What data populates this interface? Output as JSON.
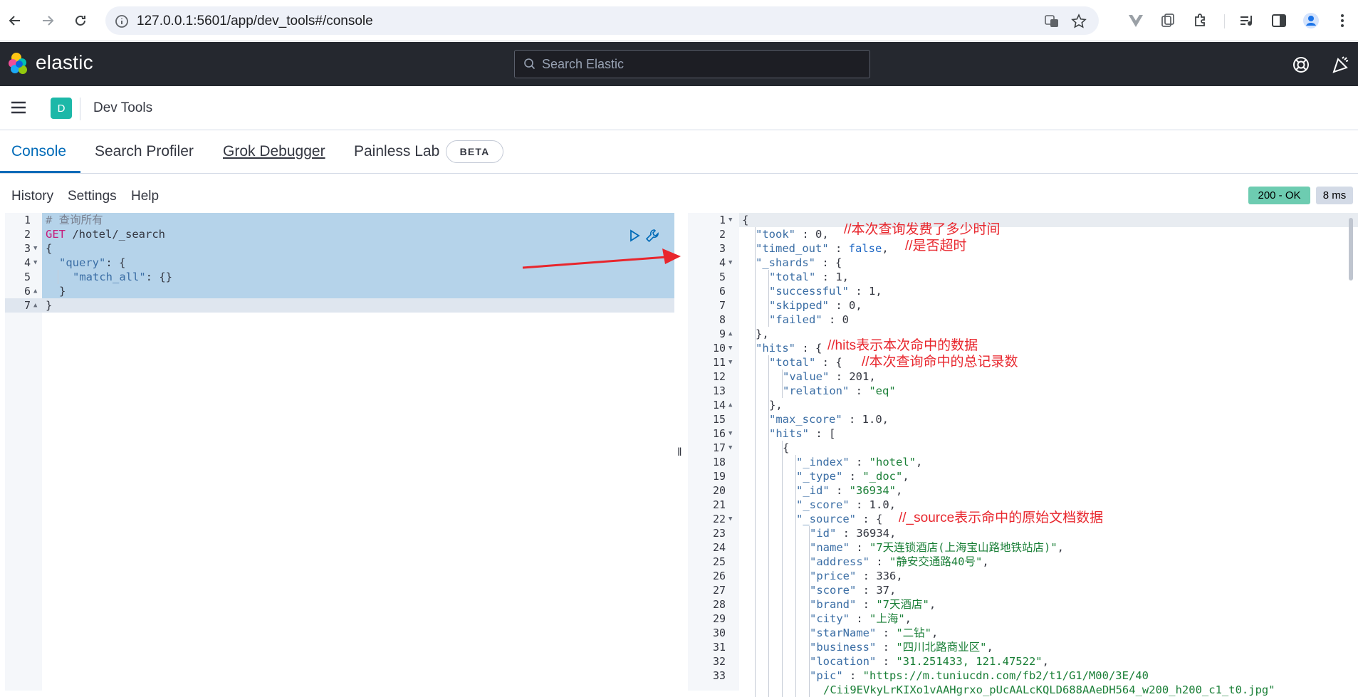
{
  "browser": {
    "url": "127.0.0.1:5601/app/dev_tools#/console"
  },
  "header": {
    "brand": "elastic",
    "search_placeholder": "Search Elastic"
  },
  "breadcrumb": {
    "space_initial": "D",
    "current": "Dev Tools"
  },
  "tabs": [
    {
      "label": "Console",
      "selected": true
    },
    {
      "label": "Search Profiler",
      "selected": false
    },
    {
      "label": "Grok Debugger",
      "selected": false
    },
    {
      "label": "Painless Lab",
      "selected": false
    }
  ],
  "beta_badge": "BETA",
  "console_menu": {
    "history": "History",
    "settings": "Settings",
    "help": "Help"
  },
  "status": {
    "code": "200 - OK",
    "time": "8 ms"
  },
  "request": {
    "comment": "# 查询所有",
    "method": "GET",
    "path": " /hotel/_search",
    "line3": "{",
    "line4_key": "\"query\"",
    "line4_rest": ": {",
    "line5_key": "\"match_all\"",
    "line5_rest": ": {}",
    "line6": "}",
    "line7": "}"
  },
  "response": {
    "l1": "{",
    "l2_key": "\"took\"",
    "l2_val": "0",
    "l2_punct": ",",
    "l3_key": "\"timed_out\"",
    "l3_val": "false",
    "l3_punct": ",",
    "l4_key": "\"_shards\"",
    "l4_rest": " : {",
    "l5_key": "\"total\"",
    "l5_val": "1",
    "l5_punct": ",",
    "l6_key": "\"successful\"",
    "l6_val": "1",
    "l6_punct": ",",
    "l7_key": "\"skipped\"",
    "l7_val": "0",
    "l7_punct": ",",
    "l8_key": "\"failed\"",
    "l8_val": "0",
    "l9": "},",
    "l10_key": "\"hits\"",
    "l10_rest": " : {",
    "l11_key": "\"total\"",
    "l11_rest": " : {",
    "l12_key": "\"value\"",
    "l12_val": "201",
    "l12_punct": ",",
    "l13_key": "\"relation\"",
    "l13_val": "\"eq\"",
    "l14": "},",
    "l15_key": "\"max_score\"",
    "l15_val": "1.0",
    "l15_punct": ",",
    "l16_key": "\"hits\"",
    "l16_rest": " : [",
    "l17": "{",
    "l18_key": "\"_index\"",
    "l18_val": "\"hotel\"",
    "l18_punct": ",",
    "l19_key": "\"_type\"",
    "l19_val": "\"_doc\"",
    "l19_punct": ",",
    "l20_key": "\"_id\"",
    "l20_val": "\"36934\"",
    "l20_punct": ",",
    "l21_key": "\"_score\"",
    "l21_val": "1.0",
    "l21_punct": ",",
    "l22_key": "\"_source\"",
    "l22_rest": " : {",
    "l23_key": "\"id\"",
    "l23_val": "36934",
    "l23_punct": ",",
    "l24_key": "\"name\"",
    "l24_val": "\"7天连锁酒店(上海宝山路地铁站店)\"",
    "l24_punct": ",",
    "l25_key": "\"address\"",
    "l25_val": "\"静安交通路40号\"",
    "l25_punct": ",",
    "l26_key": "\"price\"",
    "l26_val": "336",
    "l26_punct": ",",
    "l27_key": "\"score\"",
    "l27_val": "37",
    "l27_punct": ",",
    "l28_key": "\"brand\"",
    "l28_val": "\"7天酒店\"",
    "l28_punct": ",",
    "l29_key": "\"city\"",
    "l29_val": "\"上海\"",
    "l29_punct": ",",
    "l30_key": "\"starName\"",
    "l30_val": "\"二钻\"",
    "l30_punct": ",",
    "l31_key": "\"business\"",
    "l31_val": "\"四川北路商业区\"",
    "l31_punct": ",",
    "l32_key": "\"location\"",
    "l32_val": "\"31.251433, 121.47522\"",
    "l32_punct": ",",
    "l33_key": "\"pic\"",
    "l33_val": "\"https://m.tuniucdn.com/fb2/t1/G1/M00/3E/40",
    "l34_val": "/Cii9EVkyLrKIXo1vAAHgrxo_pUcAALcKQLD688AAeDH564_w200_h200_c1_t0.jpg\""
  },
  "annotations": {
    "took": "//本次查询发费了多少时间",
    "timed_out": "//是否超时",
    "hits": "//hits表示本次命中的数据",
    "total": "//本次查询命中的总记录数",
    "source": "//_source表示命中的原始文档数据"
  },
  "colors": {
    "accent": "#006bb8",
    "header_bg": "#25282f",
    "status_ok": "#6dccb1",
    "annotation": "#e8262d",
    "selection": "#b5d3ea"
  }
}
